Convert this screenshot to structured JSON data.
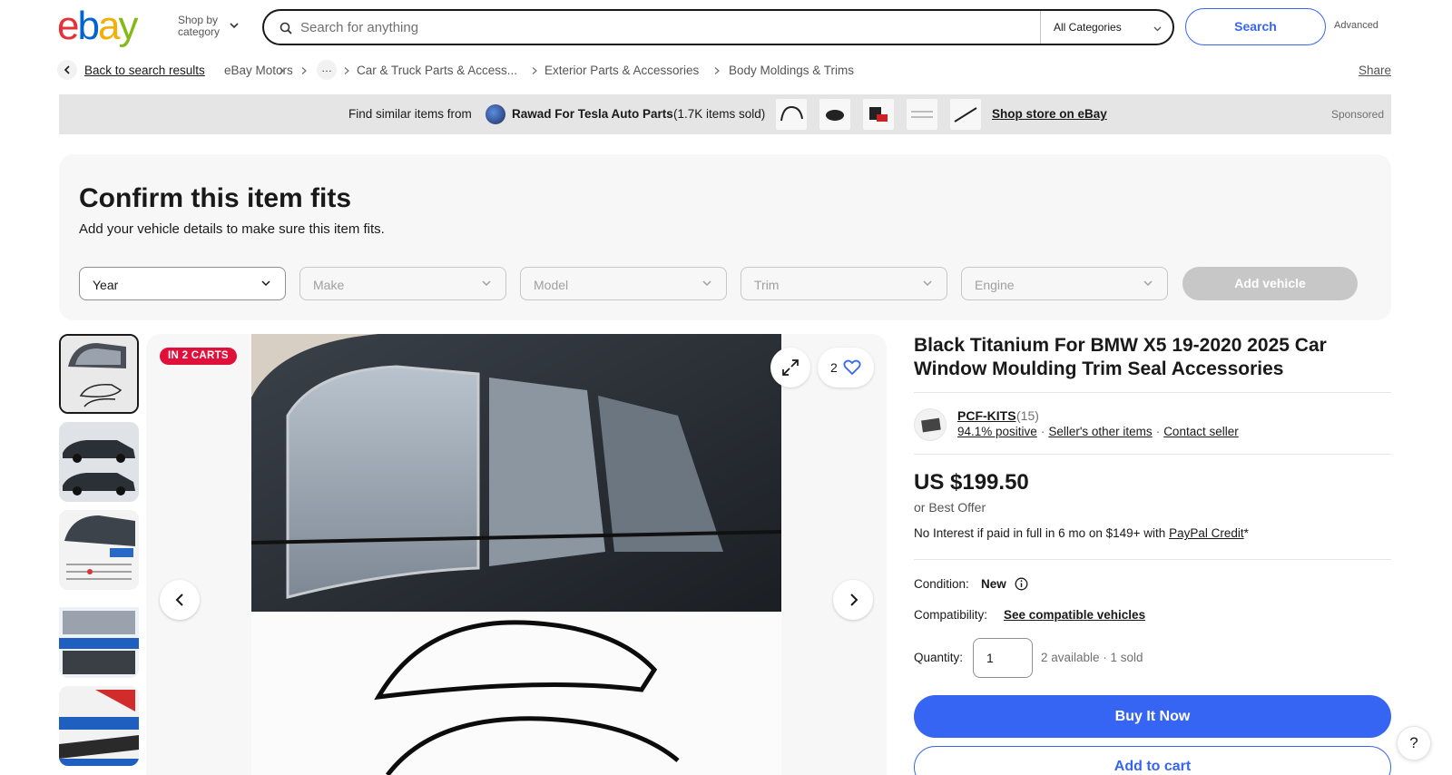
{
  "header": {
    "logo_text": "ebay",
    "shop_by_line1": "Shop by",
    "shop_by_line2": "category",
    "search_placeholder": "Search for anything",
    "category_select": "All Categories",
    "search_button": "Search",
    "advanced_link": "Advanced"
  },
  "breadcrumb": {
    "back": "Back to search results",
    "items": [
      "eBay Motors",
      "Car & Truck Parts & Access...",
      "Exterior Parts & Accessories",
      "Body Moldings & Trims"
    ],
    "more": "…",
    "share": "Share"
  },
  "banner": {
    "prefix": "Find similar items from",
    "store_name": "Rawad For Tesla Auto Parts",
    "sold": "(1.7K items sold)",
    "shop_store": "Shop store on eBay",
    "sponsored": "Sponsored"
  },
  "fitment": {
    "title": "Confirm this item fits",
    "subtitle": "Add your vehicle details to make sure this item fits.",
    "selects": [
      "Year",
      "Make",
      "Model",
      "Trim",
      "Engine"
    ],
    "add_button": "Add vehicle"
  },
  "gallery": {
    "badge": "IN 2 CARTS",
    "watch_count": "2"
  },
  "item": {
    "title": "Black Titanium For BMW X5 19-2020 2025 Car Window Moulding Trim Seal Accessories",
    "seller_name": "PCF-KITS",
    "seller_feedback_count": "(15)",
    "seller_positive": "94.1% positive",
    "seller_other": "Seller's other items",
    "contact_seller": "Contact seller",
    "price": "US $199.50",
    "best_offer": "or Best Offer",
    "credit_text": "No Interest if paid in full in 6 mo on $149+ with",
    "credit_link": "PayPal Credit",
    "credit_suffix": "*",
    "condition_label": "Condition:",
    "condition_value": "New",
    "compat_label": "Compatibility:",
    "compat_link": "See compatible vehicles",
    "quantity_label": "Quantity:",
    "quantity_value": "1",
    "availability": "2 available · 1 sold",
    "buy_now": "Buy It Now",
    "add_to_cart": "Add to cart"
  },
  "help": "?",
  "colors": {
    "accent_blue": "#3665f3",
    "badge_red": "#e0103a",
    "logo_red": "#e53238",
    "logo_blue": "#0064d2",
    "logo_yellow": "#f5af02",
    "logo_green": "#86b817"
  }
}
